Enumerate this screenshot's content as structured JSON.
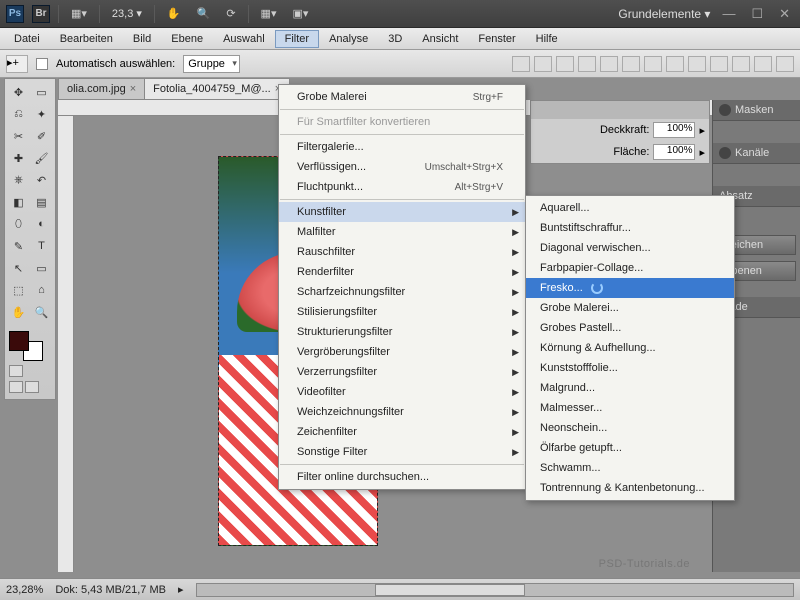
{
  "titlebar": {
    "ps": "Ps",
    "br": "Br",
    "zoom": "23,3",
    "workspace": "Grundelemente ▾"
  },
  "menu": [
    "Datei",
    "Bearbeiten",
    "Bild",
    "Ebene",
    "Auswahl",
    "Filter",
    "Analyse",
    "3D",
    "Ansicht",
    "Fenster",
    "Hilfe"
  ],
  "optbar": {
    "auto": "Automatisch auswählen:",
    "group": "Gruppe"
  },
  "tabs": [
    "olia.com.jpg",
    "Fotolia_4004759_M@..."
  ],
  "filter_menu": {
    "top": {
      "label": "Grobe Malerei",
      "sc": "Strg+F"
    },
    "smart": "Für Smartfilter konvertieren",
    "gallery": "Filtergalerie...",
    "liquify": {
      "label": "Verflüssigen...",
      "sc": "Umschalt+Strg+X"
    },
    "vanish": {
      "label": "Fluchtpunkt...",
      "sc": "Alt+Strg+V"
    },
    "groups": [
      "Kunstfilter",
      "Malfilter",
      "Rauschfilter",
      "Renderfilter",
      "Scharfzeichnungsfilter",
      "Stilisierungsfilter",
      "Strukturierungsfilter",
      "Vergröberungsfilter",
      "Verzerrungsfilter",
      "Videofilter",
      "Weichzeichnungsfilter",
      "Zeichenfilter",
      "Sonstige Filter"
    ],
    "online": "Filter online durchsuchen..."
  },
  "submenu": [
    "Aquarell...",
    "Buntstiftschraffur...",
    "Diagonal verwischen...",
    "Farbpapier-Collage...",
    "Fresko...",
    "Grobe Malerei...",
    "Grobes Pastell...",
    "Körnung & Aufhellung...",
    "Kunststofffolie...",
    "Malgrund...",
    "Malmesser...",
    "Neonschein...",
    "Ölfarbe getupft...",
    "Schwamm...",
    "Tontrennung & Kantenbetonung..."
  ],
  "submenu_selected": 4,
  "rpanel": {
    "masken": "Masken",
    "kanale": "Kanäle",
    "absatz": "Absatz",
    "zeichen": "Zeichen",
    "ebenen": "Ebenen",
    "pfade": "Pfade"
  },
  "floatpanel": {
    "deck": "Deckkraft:",
    "flache": "Fläche:",
    "val": "100%"
  },
  "status": {
    "zoom": "23,28%",
    "dok": "Dok: 5,43 MB/21,7 MB"
  },
  "watermark": "PSD-Tutorials.de"
}
